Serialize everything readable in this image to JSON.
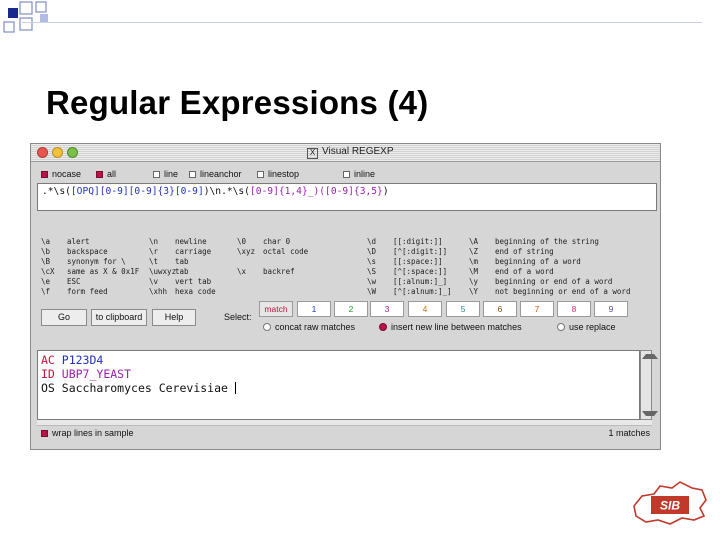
{
  "slide": {
    "title": "Regular Expressions (4)"
  },
  "window": {
    "title": "Visual REGEXP",
    "close_glyph": "X"
  },
  "options": [
    {
      "label": "nocase",
      "checked": true
    },
    {
      "label": "all",
      "checked": true
    },
    {
      "label": "line",
      "checked": false
    },
    {
      "label": "lineanchor",
      "checked": false
    },
    {
      "label": "linestop",
      "checked": false
    },
    {
      "label": "inline",
      "checked": false
    }
  ],
  "regex": {
    "part1": ".*\\s(",
    "part2": "[OPQ][0-9][0-9]{3}[0-9]",
    "part3": ")\\n.*\\s(",
    "part4": "[0-9]{1,4}_)([0-9]{3,5}",
    "part5": ")"
  },
  "cheat": {
    "col1": [
      [
        "\\a",
        "alert"
      ],
      [
        "\\b",
        "backspace"
      ],
      [
        "\\B",
        "synonym for \\"
      ],
      [
        "\\cX",
        "same as X & 0x1F"
      ],
      [
        "\\e",
        "ESC"
      ],
      [
        "\\f",
        "form feed"
      ]
    ],
    "col2": [
      [
        "\\n",
        "newline"
      ],
      [
        "\\r",
        "carriage"
      ],
      [
        "\\t",
        "tab"
      ],
      [
        "\\uwxyz",
        "tab"
      ],
      [
        "\\v",
        "vert tab"
      ],
      [
        "\\xhh",
        "hexa code"
      ]
    ],
    "col3": [
      [
        "\\0",
        "char 0"
      ],
      [
        "\\xyz",
        "octal code"
      ],
      [
        "",
        ""
      ],
      [
        "\\x",
        "backref"
      ],
      [
        "",
        ""
      ],
      [
        "",
        ""
      ]
    ],
    "col4": [
      [
        "\\d",
        "[[:digit:]]"
      ],
      [
        "\\D",
        "[^[:digit:]]"
      ],
      [
        "\\s",
        "[[:space:]]"
      ],
      [
        "\\S",
        "[^[:space:]]"
      ],
      [
        "\\w",
        "[[:alnum:]_]"
      ],
      [
        "\\W",
        "[^[:alnum:]_]"
      ]
    ],
    "col5": [
      [
        "\\A",
        "beginning of the string"
      ],
      [
        "\\Z",
        "end of string"
      ],
      [
        "\\m",
        "beginning of a word"
      ],
      [
        "\\M",
        "end of a word"
      ],
      [
        "\\y",
        "beginning or end of a word"
      ],
      [
        "\\Y",
        "not beginning or end of a word"
      ]
    ]
  },
  "buttons": {
    "go": "Go",
    "clipboard": "to clipboard",
    "help": "Help"
  },
  "select_label": "Select:",
  "groups": [
    {
      "label": "match",
      "color": "#c0143c"
    },
    {
      "label": "1",
      "color": "#2040c0"
    },
    {
      "label": "2",
      "color": "#2a9a2a"
    },
    {
      "label": "3",
      "color": "#b02080"
    },
    {
      "label": "4",
      "color": "#c07800"
    },
    {
      "label": "5",
      "color": "#2a8a8a"
    },
    {
      "label": "6",
      "color": "#8a4a10"
    },
    {
      "label": "7",
      "color": "#c06020"
    },
    {
      "label": "8",
      "color": "#d03070"
    },
    {
      "label": "9",
      "color": "#5050a0"
    }
  ],
  "radios": [
    {
      "label": "concat raw matches",
      "checked": false
    },
    {
      "label": "insert new line between matches",
      "checked": true
    },
    {
      "label": "use replace",
      "checked": false
    }
  ],
  "sample": [
    {
      "prefix": "AC",
      "prefix_color": "#c0143c",
      "rest": " P123D4",
      "rest_color": "#2030c0"
    },
    {
      "prefix": "ID",
      "prefix_color": "#c0143c",
      "rest": " UBP7_YEAST",
      "rest_color": "#9a1fb0"
    },
    {
      "prefix": "OS",
      "prefix_color": "#111111",
      "rest": " Saccharomyces Cerevisiae ",
      "rest_color": "#111111"
    }
  ],
  "bottom": {
    "wrap_label": "wrap lines in sample",
    "wrap_checked": true,
    "matches": "1 matches"
  },
  "logo": {
    "text": "SIB"
  }
}
